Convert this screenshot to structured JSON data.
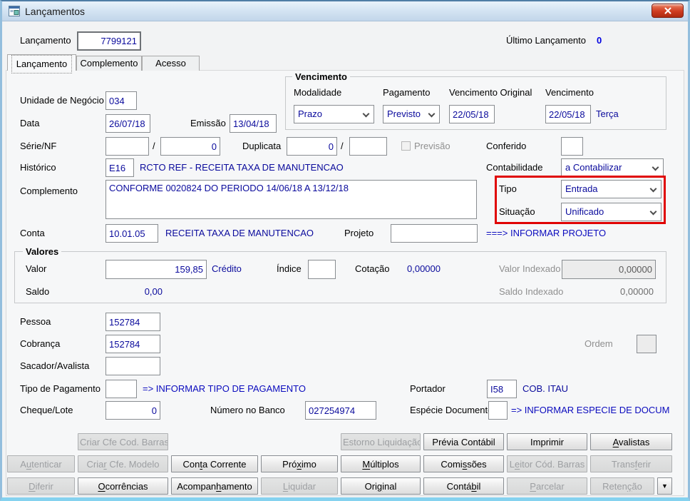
{
  "window": {
    "title": "Lançamentos"
  },
  "header": {
    "lancamento_label": "Lançamento",
    "lancamento_value": "7799121",
    "ultimo_label": "Último Lançamento",
    "ultimo_value": "0"
  },
  "tabs": [
    {
      "label": "Lançamento",
      "active": true
    },
    {
      "label": "Complemento",
      "active": false
    },
    {
      "label": "Acesso",
      "active": false
    }
  ],
  "form": {
    "unidade": {
      "label": "Unidade de Negócio",
      "value": "034"
    },
    "data": {
      "label": "Data",
      "value": "26/07/18"
    },
    "emissao": {
      "label": "Emissão",
      "value": "13/04/18"
    },
    "vencimento_group": {
      "title": "Vencimento",
      "modalidade": {
        "label": "Modalidade",
        "value": "Prazo"
      },
      "pagamento": {
        "label": "Pagamento",
        "value": "Previsto"
      },
      "vencimento_original": {
        "label": "Vencimento Original",
        "value": "22/05/18"
      },
      "vencimento": {
        "label": "Vencimento",
        "value": "22/05/18",
        "weekday": "Terça"
      }
    },
    "serie_nf": {
      "label": "Série/NF",
      "value1": "",
      "separator": "/",
      "value2": "0"
    },
    "duplicata": {
      "label": "Duplicata",
      "value1": "0",
      "separator": "/",
      "value2": ""
    },
    "previsao": {
      "label": "Previsão"
    },
    "conferido": {
      "label": "Conferido",
      "value": ""
    },
    "historico": {
      "label": "Histórico",
      "code": "E16",
      "description": "RCTO REF - RECEITA TAXA DE MANUTENCAO"
    },
    "contabilidade": {
      "label": "Contabilidade",
      "value": "a Contabilizar"
    },
    "complemento": {
      "label": "Complemento",
      "value": "CONFORME 0020824 DO PERIODO 14/06/18 A 13/12/18"
    },
    "tipo": {
      "label": "Tipo",
      "value": "Entrada"
    },
    "situacao": {
      "label": "Situação",
      "value": "Unificado"
    },
    "conta": {
      "label": "Conta",
      "code": "10.01.05",
      "description": "RECEITA TAXA DE MANUTENCAO"
    },
    "projeto": {
      "label": "Projeto",
      "value": "",
      "hint": "===> INFORMAR PROJETO"
    },
    "valores_group": {
      "title": "Valores",
      "valor": {
        "label": "Valor",
        "value": "159,85",
        "suffix": "Crédito"
      },
      "indice": {
        "label": "Índice",
        "value": ""
      },
      "cotacao": {
        "label": "Cotação",
        "value": "0,00000"
      },
      "valor_indexado": {
        "label": "Valor Indexado",
        "value": "0,00000"
      },
      "saldo": {
        "label": "Saldo",
        "value": "0,00"
      },
      "saldo_indexado": {
        "label": "Saldo Indexado",
        "value": "0,00000"
      }
    },
    "pessoa": {
      "label": "Pessoa",
      "value": "152784"
    },
    "cobranca": {
      "label": "Cobrança",
      "value": "152784"
    },
    "ordem": {
      "label": "Ordem",
      "value": ""
    },
    "sacador": {
      "label": "Sacador/Avalista",
      "value": ""
    },
    "tipo_pagamento": {
      "label": "Tipo de Pagamento",
      "value": "",
      "hint": "=> INFORMAR TIPO DE PAGAMENTO"
    },
    "portador": {
      "label": "Portador",
      "code": "I58",
      "description": "COB. ITAU"
    },
    "cheque_lote": {
      "label": "Cheque/Lote",
      "value": "0"
    },
    "numero_banco": {
      "label": "Número no Banco",
      "value": "027254974"
    },
    "especie": {
      "label": "Espécie Documento",
      "value": "",
      "hint": "=> INFORMAR ESPECIE DE DOCUM"
    }
  },
  "buttons": {
    "rows": [
      [
        {
          "label": "Criar Cfe Cod. Barras",
          "col": 2,
          "enabled": false
        },
        {
          "label": "Estorno Liquidação",
          "col": 5,
          "enabled": false
        },
        {
          "label": "Prévia Contábil",
          "col": 6,
          "enabled": true
        },
        {
          "label": "Imprimir",
          "col": 7,
          "enabled": true
        },
        {
          "label": "Avalistas",
          "col": 8,
          "span": 2,
          "enabled": true,
          "u": 0
        }
      ],
      [
        {
          "label": "Autenticar",
          "col": 1,
          "enabled": false,
          "u": 1
        },
        {
          "label": "Criar Cfe. Modelo",
          "col": 2,
          "enabled": false,
          "u": 4
        },
        {
          "label": "Conta Corrente",
          "col": 3,
          "enabled": true,
          "u": 3
        },
        {
          "label": "Próximo",
          "col": 4,
          "enabled": true,
          "u": 3
        },
        {
          "label": "Múltiplos",
          "col": 5,
          "enabled": true,
          "u": 0
        },
        {
          "label": "Comissões",
          "col": 6,
          "enabled": true,
          "u": 4
        },
        {
          "label": "Leitor Cód. Barras",
          "col": 7,
          "enabled": false,
          "u": 1
        },
        {
          "label": "Transferir",
          "col": 8,
          "span": 2,
          "enabled": false,
          "u": 5
        }
      ],
      [
        {
          "label": "Diferir",
          "col": 1,
          "enabled": false,
          "u": 0
        },
        {
          "label": "Ocorrências",
          "col": 2,
          "enabled": true,
          "u": 0
        },
        {
          "label": "Acompanhamento",
          "col": 3,
          "enabled": true,
          "u": 7
        },
        {
          "label": "Liquidar",
          "col": 4,
          "enabled": false,
          "u": 0
        },
        {
          "label": "Original",
          "col": 5,
          "enabled": true,
          "u": 3
        },
        {
          "label": "Contábil",
          "col": 6,
          "enabled": true,
          "u": 5
        },
        {
          "label": "Parcelar",
          "col": 7,
          "enabled": false,
          "u": 0
        },
        {
          "label": "Retenção",
          "col": 8,
          "enabled": false,
          "u": 5
        },
        {
          "label": "▼",
          "col": 9,
          "enabled": true,
          "arrow": true
        }
      ]
    ]
  },
  "colors": {
    "value_navy": "#0a0a9c",
    "hint_blue": "#0b0bbe",
    "highlight_red": "#e00404",
    "ultimo_blue": "#0000e0"
  }
}
